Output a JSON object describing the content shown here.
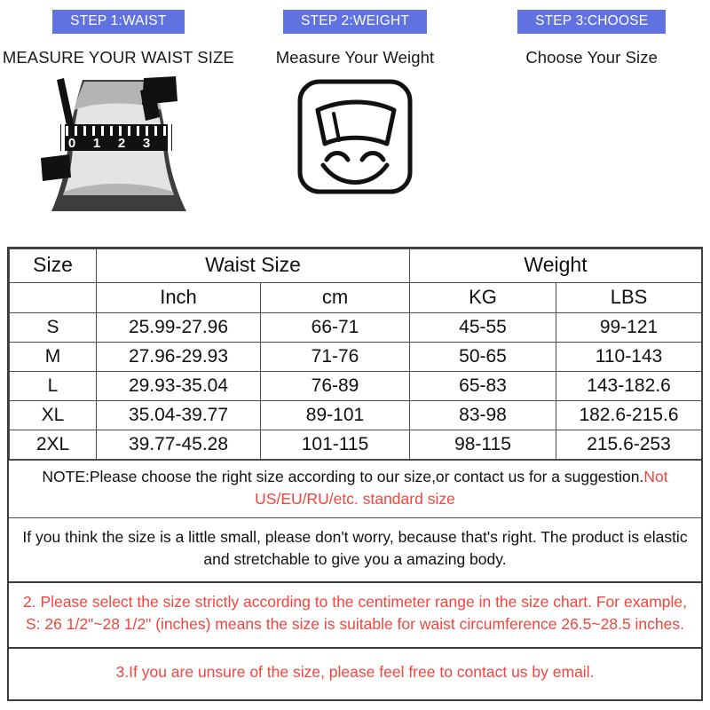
{
  "steps": [
    {
      "badge": "STEP 1:WAIST",
      "title": "MEASURE YOUR WAIST SIZE",
      "art": "waist-measure-illustration",
      "tape_marks": [
        "0",
        "1",
        "2",
        "3"
      ]
    },
    {
      "badge": "STEP 2:WEIGHT",
      "title": "Measure Your Weight",
      "art": "bathroom-scale-illustration",
      "tape_marks": []
    },
    {
      "badge": "STEP 3:CHOOSE",
      "title": "Choose Your Size",
      "art": "",
      "tape_marks": []
    }
  ],
  "table": {
    "group_headers": {
      "size": "Size",
      "waist": "Waist Size",
      "weight": "Weight"
    },
    "sub_headers": {
      "inch": "Inch",
      "cm": "cm",
      "kg": "KG",
      "lbs": "LBS"
    },
    "rows": [
      {
        "size": "S",
        "inch": "25.99-27.96",
        "cm": "66-71",
        "kg": "45-55",
        "lbs": "99-121"
      },
      {
        "size": "M",
        "inch": "27.96-29.93",
        "cm": "71-76",
        "kg": "50-65",
        "lbs": "110-143"
      },
      {
        "size": "L",
        "inch": "29.93-35.04",
        "cm": "76-89",
        "kg": "65-83",
        "lbs": "143-182.6"
      },
      {
        "size": "XL",
        "inch": "35.04-39.77",
        "cm": "89-101",
        "kg": "83-98",
        "lbs": "182.6-215.6"
      },
      {
        "size": "2XL",
        "inch": "39.77-45.28",
        "cm": "101-115",
        "kg": "98-115",
        "lbs": "215.6-253"
      }
    ]
  },
  "notes": {
    "note1_black": "NOTE:Please choose the right size according to our size,or contact us for a suggestion.",
    "note1_red": "Not US/EU/RU/etc. standard size",
    "note2": "If you think the size is a little small, please don't worry, because that's right. The product is elastic and stretchable to give you a amazing body.",
    "note3": "2. Please select the size strictly according to the centimeter range in the size chart. For example, S: 26 1/2\"~28 1/2\" (inches) means the size is suitable for waist circumference 26.5~28.5 inches.",
    "note4": "3.If you are unsure of the size, please feel free to contact us by email."
  },
  "colors": {
    "badge_blue": "#5f72e0",
    "accent_red": "#f4443c",
    "text_black": "#111111",
    "border_gray": "#4a4a4a"
  }
}
